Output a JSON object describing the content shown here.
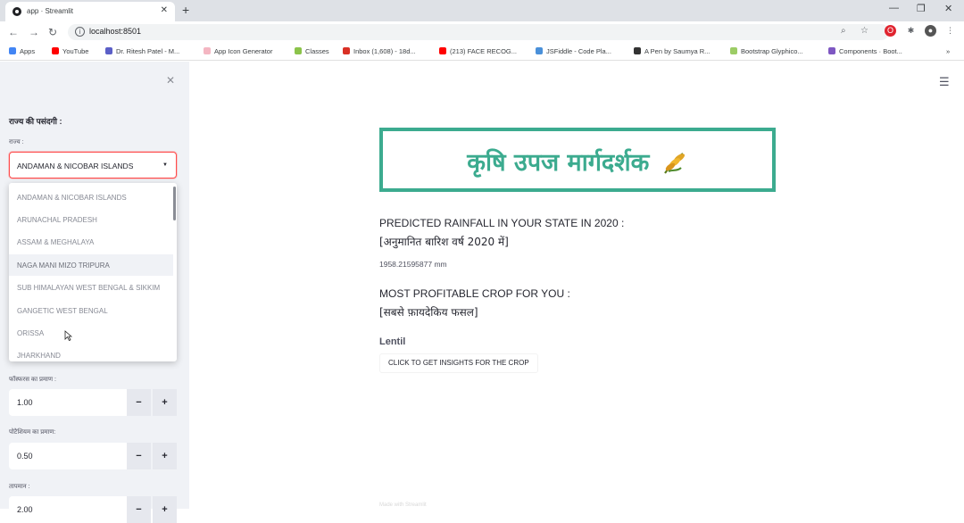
{
  "browser": {
    "tab_title": "app · Streamlit",
    "url": "localhost:8501",
    "bookmarks": [
      {
        "label": "Apps",
        "color": "#4285f4"
      },
      {
        "label": "YouTube",
        "color": "#ff0000"
      },
      {
        "label": "Dr. Ritesh Patel - M...",
        "color": "#5b5fc7"
      },
      {
        "label": "App Icon Generator",
        "color": "#f4b6c2"
      },
      {
        "label": "Classes",
        "color": "#8bc34a"
      },
      {
        "label": "Inbox (1,608) - 18d...",
        "color": "#d93025"
      },
      {
        "label": "(213) FACE RECOG...",
        "color": "#ff0000"
      },
      {
        "label": "JSFiddle - Code Pla...",
        "color": "#4a90d9"
      },
      {
        "label": "A Pen by Saumya R...",
        "color": "#333333"
      },
      {
        "label": "Bootstrap Glyphico...",
        "color": "#9ccc65"
      },
      {
        "label": "Components · Boot...",
        "color": "#7e57c2"
      }
    ]
  },
  "sidebar": {
    "header": "राज्य की पसंदगी :",
    "state_label": "राज्य :",
    "selected_state": "ANDAMAN & NICOBAR ISLANDS",
    "options": [
      "ANDAMAN & NICOBAR ISLANDS",
      "ARUNACHAL PRADESH",
      "ASSAM & MEGHALAYA",
      "NAGA MANI MIZO TRIPURA",
      "SUB HIMALAYAN WEST BENGAL & SIKKIM",
      "GANGETIC WEST BENGAL",
      "ORISSA",
      "JHARKHAND"
    ],
    "hovered_option_index": 3,
    "phosphorus_label": "फॉस्फरस का प्रमाण :",
    "phosphorus_value": "1.00",
    "potassium_label": "पोटैशियम का प्रमाण:",
    "potassium_value": "0.50",
    "temperature_label": "तापमान :",
    "temperature_value": "2.00",
    "minus": "−",
    "plus": "+"
  },
  "main": {
    "title": "कृषि उपज मार्गदर्शक",
    "accent_color": "#3cab8f",
    "rain_heading_en": "PREDICTED RAINFALL IN YOUR STATE IN 2020 :",
    "rain_heading_hi": "[अनुमानित बारिश वर्ष 2020 में]",
    "rain_value": "1958.21595877 mm",
    "crop_heading_en": "MOST PROFITABLE CROP FOR YOU :",
    "crop_heading_hi": "[सबसे फ़ायदेकिय फसल]",
    "crop_value": "Lentil",
    "cta_label": "CLICK TO GET INSIGHTS FOR THE CROP",
    "footer": "Made with Streamlit"
  }
}
